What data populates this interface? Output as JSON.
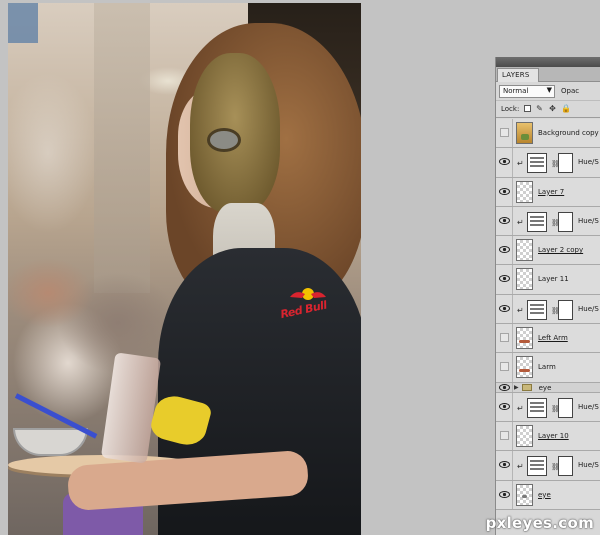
{
  "panel": {
    "tab_label": "LAYERS",
    "blend_mode": "Normal",
    "opacity_label": "Opac",
    "lock_label": "Lock:"
  },
  "layers": [
    {
      "name": "Background copy",
      "type": "pixel",
      "visible": false,
      "underlined": false
    },
    {
      "name": "Hue/S",
      "type": "adjustment",
      "visible": true
    },
    {
      "name": "Layer 7",
      "type": "pixel",
      "visible": true,
      "underlined": true
    },
    {
      "name": "Hue/S",
      "type": "adjustment",
      "visible": true
    },
    {
      "name": "Layer 2 copy",
      "type": "pixel",
      "visible": true,
      "underlined": true
    },
    {
      "name": "Layer 11",
      "type": "pixel",
      "visible": true,
      "underlined": false
    },
    {
      "name": "Hue/S",
      "type": "adjustment",
      "visible": true
    },
    {
      "name": "Left Arm",
      "type": "pixel",
      "visible": false,
      "underlined": true
    },
    {
      "name": "Larm",
      "type": "pixel",
      "visible": false,
      "underlined": false
    },
    {
      "name": "eye",
      "type": "group",
      "visible": true
    },
    {
      "name": "Hue/S",
      "type": "adjustment",
      "visible": true
    },
    {
      "name": "Layer 10",
      "type": "pixel",
      "visible": false,
      "underlined": true
    },
    {
      "name": "Hue/S",
      "type": "adjustment",
      "visible": true
    },
    {
      "name": "eye",
      "type": "pixel",
      "visible": true,
      "underlined": true
    }
  ],
  "photo": {
    "shirt_logo_text": "Red Bull"
  },
  "watermark": "pxleyes.com",
  "colors": {
    "panel_bg": "#d8d8d8",
    "workspace_bg": "#c3c3c3",
    "redbull_red": "#d9242f"
  }
}
